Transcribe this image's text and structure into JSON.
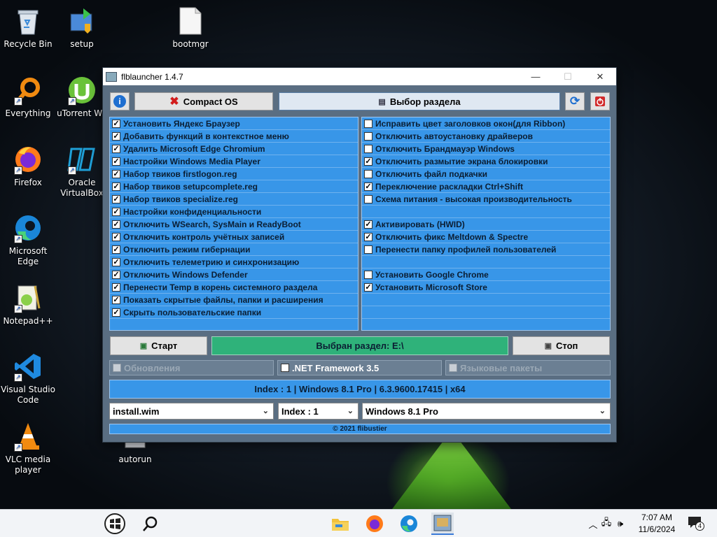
{
  "desktop": {
    "icons": [
      {
        "label": "Recycle Bin"
      },
      {
        "label": "setup"
      },
      {
        "label": "bootmgr"
      },
      {
        "label": "Everything"
      },
      {
        "label": "uTorrent We"
      },
      {
        "label": "Firefox"
      },
      {
        "label": "Oracle VirtualBox"
      },
      {
        "label": "Microsoft Edge"
      },
      {
        "label": "Notepad++"
      },
      {
        "label": "Visual Studio Code"
      },
      {
        "label": "VLC media player"
      },
      {
        "label": "autorun"
      }
    ]
  },
  "window": {
    "title": "flblauncher 1.4.7",
    "info_glyph": "i",
    "compact_os_label": "Compact OS",
    "select_partition_label": "Выбор раздела",
    "left_options": [
      {
        "label": "Установить Яндекс Браузер",
        "checked": true
      },
      {
        "label": "Добавить функций в контекстное меню",
        "checked": true
      },
      {
        "label": "Удалить Microsoft Edge Chromium",
        "checked": true
      },
      {
        "label": "Настройки Windows Media Player",
        "checked": true
      },
      {
        "label": "Набор твиков firstlogon.reg",
        "checked": true
      },
      {
        "label": "Набор твиков setupcomplete.reg",
        "checked": true
      },
      {
        "label": "Набор твиков specialize.reg",
        "checked": true
      },
      {
        "label": "Настройки конфиденциальности",
        "checked": true
      },
      {
        "label": "Отключить WSearch, SysMain и ReadyBoot",
        "checked": true
      },
      {
        "label": "Отключить контроль учётных записей",
        "checked": true
      },
      {
        "label": "Отключить режим гибернации",
        "checked": true
      },
      {
        "label": "Отключить телеметрию и синхронизацию",
        "checked": true
      },
      {
        "label": "Отключить Windows Defender",
        "checked": true
      },
      {
        "label": "Перенести Temp в корень системного раздела",
        "checked": true
      },
      {
        "label": "Показать скрытые файлы, папки и расширения",
        "checked": true
      },
      {
        "label": "Скрыть пользовательские папки",
        "checked": true
      }
    ],
    "right_options": [
      {
        "label": "Исправить цвет заголовков окон(для Ribbon)",
        "checked": false
      },
      {
        "label": "Отключить автоустановку драйверов",
        "checked": false
      },
      {
        "label": "Отключить Брандмауэр Windows",
        "checked": false
      },
      {
        "label": "Отключить размытие экрана блокировки",
        "checked": true
      },
      {
        "label": "Отключить файл подкачки",
        "checked": false
      },
      {
        "label": "Переключение раскладки Ctrl+Shift",
        "checked": true
      },
      {
        "label": "Схема питания - высокая производительность",
        "checked": false
      },
      {
        "label": "",
        "checked": null
      },
      {
        "label": "Активировать (HWID)",
        "checked": true
      },
      {
        "label": "Отключить фикс Meltdown & Spectre",
        "checked": true
      },
      {
        "label": "Перенести папку профилей пользователей",
        "checked": false
      },
      {
        "label": "",
        "checked": null
      },
      {
        "label": "Установить Google Chrome",
        "checked": false
      },
      {
        "label": "Установить Microsoft Store",
        "checked": true
      },
      {
        "label": "",
        "checked": null
      },
      {
        "label": "",
        "checked": null
      }
    ],
    "start_label": "Старт",
    "selected_partition_status": "Выбран раздел: E:\\",
    "stop_label": "Стоп",
    "updates_label": "Обновления",
    "netfx_label": ".NET Framework 3.5",
    "lang_packs_label": "Языковые пакеты",
    "image_info": "Index : 1 | Windows 8.1 Pro | 6.3.9600.17415 | x64",
    "wim_select": "install.wim",
    "index_select": "Index : 1",
    "edition_select": "Windows 8.1 Pro",
    "footer": "© 2021 flibustier"
  },
  "taskbar": {
    "time": "7:07 AM",
    "date": "11/6/2024",
    "notification_count": "4"
  },
  "colors": {
    "panel_blue": "#3896e8",
    "status_green": "#2fb27a",
    "window_bg": "#5a6e82"
  }
}
